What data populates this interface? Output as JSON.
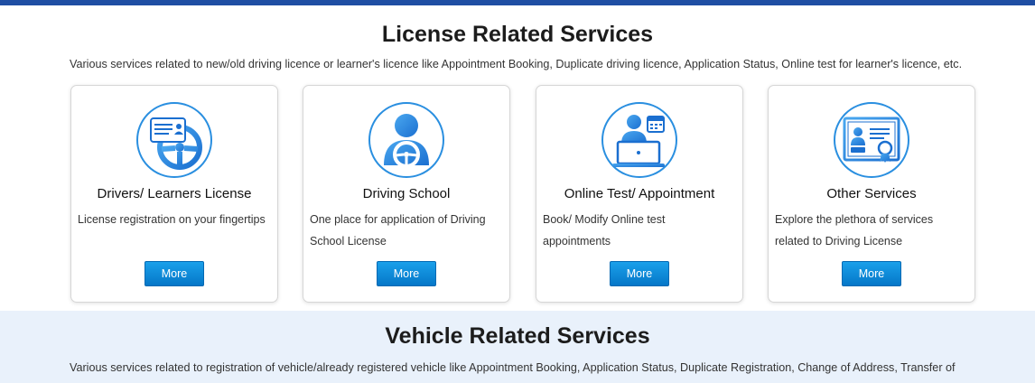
{
  "license": {
    "title": "License Related Services",
    "description": "Various services related to new/old driving licence or learner's licence like Appointment Booking, Duplicate driving licence, Application Status, Online test for learner's licence, etc.",
    "cards": [
      {
        "title": "Drivers/ Learners License",
        "description": "License registration on your fingertips",
        "button": "More",
        "icon": "license-steering-icon"
      },
      {
        "title": "Driving School",
        "description": "One place for application of Driving School License",
        "button": "More",
        "icon": "driver-steering-icon"
      },
      {
        "title": "Online Test/ Appointment",
        "description": "Book/ Modify Online test appointments",
        "button": "More",
        "icon": "online-test-calendar-icon"
      },
      {
        "title": "Other Services",
        "description": "Explore the plethora of services related to Driving License",
        "button": "More",
        "icon": "certificate-icon"
      }
    ]
  },
  "vehicle": {
    "title": "Vehicle Related Services",
    "description": "Various services related to registration of vehicle/already registered vehicle like Appointment Booking, Application Status, Duplicate Registration, Change of Address, Transfer of"
  },
  "colors": {
    "top_bar": "#1f4ea3",
    "icon_blue": "#2a8fe0",
    "button": "#0a84d6",
    "vehicle_bg": "#e9f1fb"
  }
}
